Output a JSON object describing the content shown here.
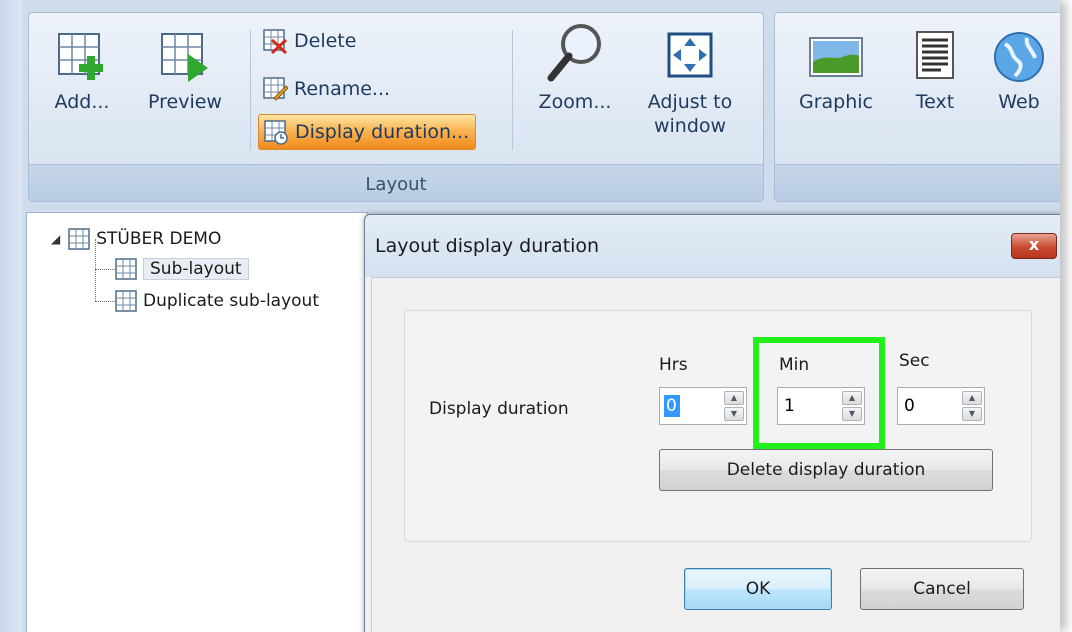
{
  "ribbon": {
    "layout_group_label": "Layout",
    "buttons": {
      "add": "Add...",
      "preview": "Preview",
      "delete": "Delete",
      "rename": "Rename...",
      "display_duration": "Display duration...",
      "zoom": "Zoom...",
      "adjust_line1": "Adjust to",
      "adjust_line2": "window",
      "graphic": "Graphic",
      "text": "Text",
      "web": "Web"
    }
  },
  "tree": {
    "root": "STÜBER DEMO",
    "children": [
      "Sub-layout",
      "Duplicate sub-layout"
    ],
    "selected": "Sub-layout"
  },
  "dialog": {
    "title": "Layout display duration",
    "close_glyph": "x",
    "field_label": "Display duration",
    "columns": {
      "hrs": "Hrs",
      "min": "Min",
      "sec": "Sec"
    },
    "values": {
      "hrs": "0",
      "min": "1",
      "sec": "0"
    },
    "delete_button": "Delete display duration",
    "ok": "OK",
    "cancel": "Cancel"
  },
  "colors": {
    "highlight": "#22f01a",
    "active_button": "#f28a1a",
    "ribbon_bg": "#dfe8f4"
  }
}
